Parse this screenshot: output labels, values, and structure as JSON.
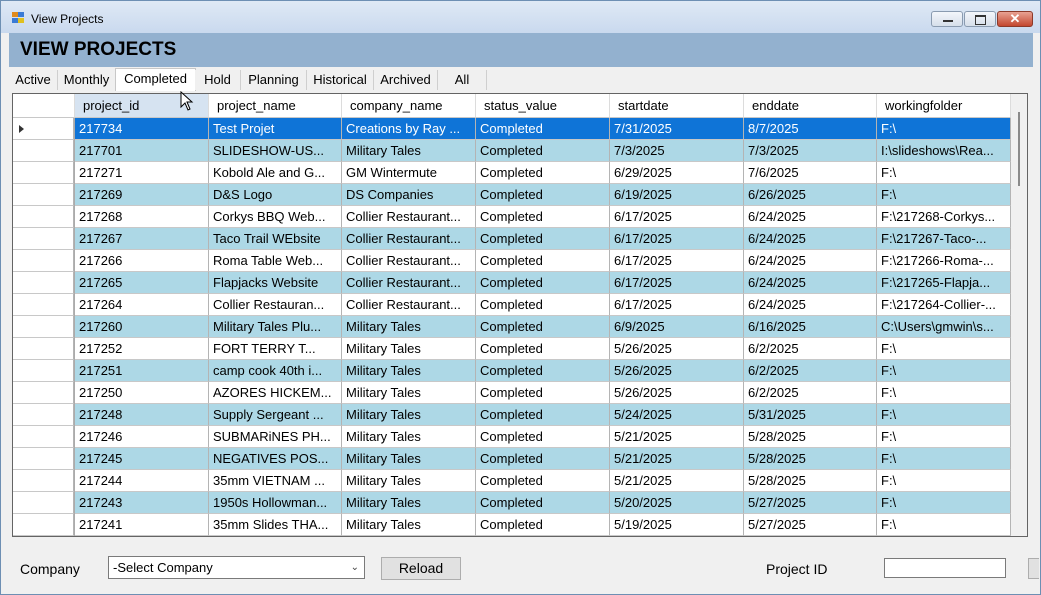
{
  "window": {
    "title": "View Projects"
  },
  "header": {
    "title": "VIEW PROJECTS"
  },
  "tabs": [
    {
      "label": "Active"
    },
    {
      "label": "Monthly"
    },
    {
      "label": "Completed"
    },
    {
      "label": "Hold"
    },
    {
      "label": "Planning"
    },
    {
      "label": "Historical"
    },
    {
      "label": "Archived"
    },
    {
      "label": "All"
    }
  ],
  "grid": {
    "columns": [
      "project_id",
      "project_name",
      "company_name",
      "status_value",
      "startdate",
      "enddate",
      "workingfolder"
    ],
    "rows": [
      [
        "217734",
        "Test Projet",
        "Creations by Ray ...",
        "Completed",
        "7/31/2025",
        "8/7/2025",
        "F:\\"
      ],
      [
        "217701",
        "SLIDESHOW-US...",
        "Military Tales",
        "Completed",
        "7/3/2025",
        "7/3/2025",
        "I:\\slideshows\\Rea..."
      ],
      [
        "217271",
        "Kobold Ale and G...",
        "GM Wintermute",
        "Completed",
        "6/29/2025",
        "7/6/2025",
        "F:\\"
      ],
      [
        "217269",
        "D&S Logo",
        "DS Companies",
        "Completed",
        "6/19/2025",
        "6/26/2025",
        "F:\\"
      ],
      [
        "217268",
        "Corkys BBQ Web...",
        "Collier Restaurant...",
        "Completed",
        "6/17/2025",
        "6/24/2025",
        "F:\\217268-Corkys..."
      ],
      [
        "217267",
        "Taco Trail WEbsite",
        "Collier Restaurant...",
        "Completed",
        "6/17/2025",
        "6/24/2025",
        "F:\\217267-Taco-..."
      ],
      [
        "217266",
        "Roma Table Web...",
        "Collier Restaurant...",
        "Completed",
        "6/17/2025",
        "6/24/2025",
        "F:\\217266-Roma-..."
      ],
      [
        "217265",
        "Flapjacks Website",
        "Collier Restaurant...",
        "Completed",
        "6/17/2025",
        "6/24/2025",
        "F:\\217265-Flapja..."
      ],
      [
        "217264",
        "Collier Restauran...",
        "Collier Restaurant...",
        "Completed",
        "6/17/2025",
        "6/24/2025",
        "F:\\217264-Collier-..."
      ],
      [
        "217260",
        "Military Tales Plu...",
        "Military Tales",
        "Completed",
        "6/9/2025",
        "6/16/2025",
        "C:\\Users\\gmwin\\s..."
      ],
      [
        "217252",
        "FORT TERRY T...",
        "Military Tales",
        "Completed",
        "5/26/2025",
        "6/2/2025",
        "F:\\"
      ],
      [
        "217251",
        "camp cook 40th i...",
        "Military Tales",
        "Completed",
        "5/26/2025",
        "6/2/2025",
        "F:\\"
      ],
      [
        "217250",
        "AZORES HICKEM...",
        "Military Tales",
        "Completed",
        "5/26/2025",
        "6/2/2025",
        "F:\\"
      ],
      [
        "217248",
        "Supply Sergeant ...",
        "Military Tales",
        "Completed",
        "5/24/2025",
        "5/31/2025",
        "F:\\"
      ],
      [
        "217246",
        "SUBMARiNES PH...",
        "Military Tales",
        "Completed",
        "5/21/2025",
        "5/28/2025",
        "F:\\"
      ],
      [
        "217245",
        "NEGATIVES POS...",
        "Military Tales",
        "Completed",
        "5/21/2025",
        "5/28/2025",
        "F:\\"
      ],
      [
        "217244",
        "35mm VIETNAM ...",
        "Military Tales",
        "Completed",
        "5/21/2025",
        "5/28/2025",
        "F:\\"
      ],
      [
        "217243",
        "1950s Hollowman...",
        "Military Tales",
        "Completed",
        "5/20/2025",
        "5/27/2025",
        "F:\\"
      ],
      [
        "217241",
        "35mm Slides THA...",
        "Military Tales",
        "Completed",
        "5/19/2025",
        "5/27/2025",
        "F:\\"
      ]
    ]
  },
  "filters": {
    "company_label": "Company",
    "company_selected": "-Select Company",
    "reload_label": "Reload",
    "project_id_label": "Project ID",
    "project_id_value": ""
  },
  "colors": {
    "header_band": "#93b1cf",
    "row_alt": "#add8e6",
    "row_selected": "#0f74d7"
  },
  "icons": {
    "row_pointer": "triangle-right-icon",
    "dropdown": "chevron-down-icon",
    "cursor": "mouse-pointer-icon"
  }
}
